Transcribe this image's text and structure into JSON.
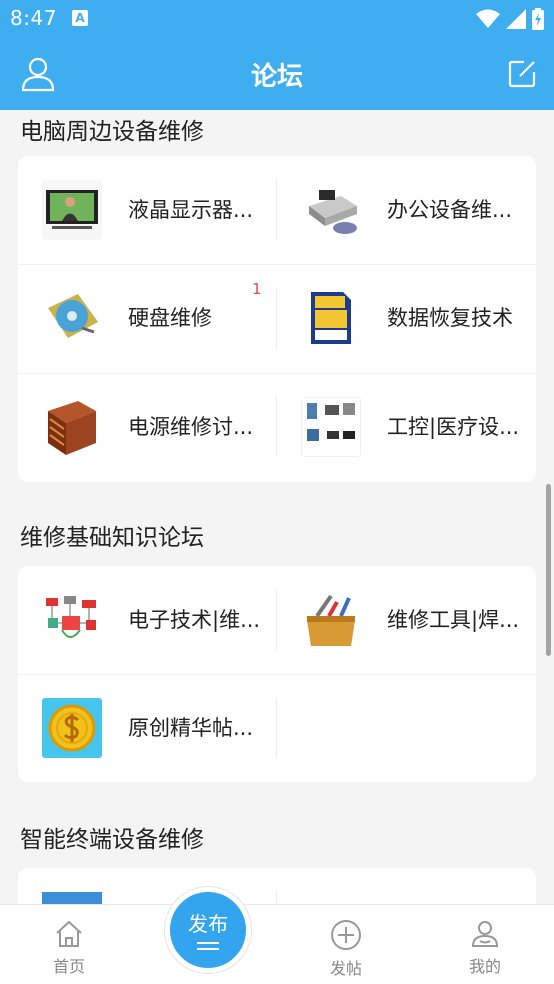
{
  "status": {
    "time": "8:47",
    "app_badge": "A"
  },
  "header": {
    "title": "论坛"
  },
  "sections": [
    {
      "title": "电脑周边设备维修",
      "items": [
        {
          "label": "液晶显示器...",
          "badge": ""
        },
        {
          "label": "办公设备维...",
          "badge": ""
        },
        {
          "label": "硬盘维修",
          "badge": "1"
        },
        {
          "label": "数据恢复技术",
          "badge": ""
        },
        {
          "label": "电源维修讨...",
          "badge": ""
        },
        {
          "label": "工控|医疗设...",
          "badge": ""
        }
      ]
    },
    {
      "title": "维修基础知识论坛",
      "items": [
        {
          "label": "电子技术|维...",
          "badge": ""
        },
        {
          "label": "维修工具|焊...",
          "badge": ""
        },
        {
          "label": "原创精华帖...",
          "badge": ""
        }
      ]
    },
    {
      "title": "智能终端设备维修",
      "items": []
    }
  ],
  "tabbar": {
    "home": "首页",
    "publish_main": "发布",
    "post": "发帖",
    "mine": "我的"
  },
  "colors": {
    "primary": "#3faef0",
    "publish": "#33a5ee",
    "badge": "#e84a4a"
  }
}
